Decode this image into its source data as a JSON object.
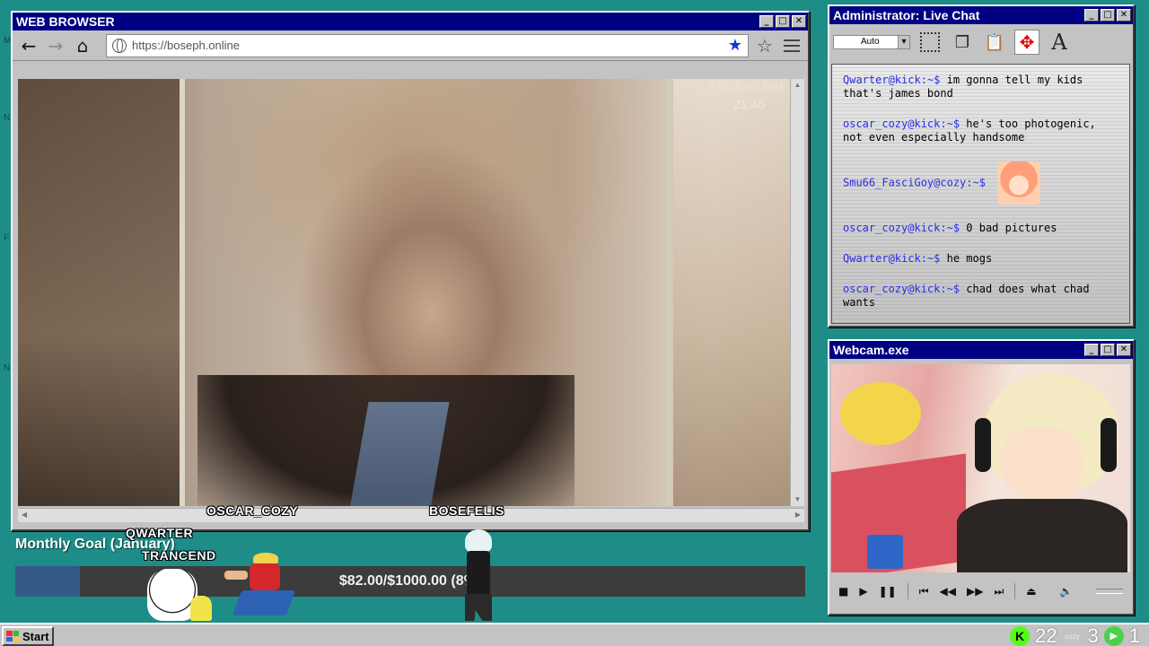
{
  "browser": {
    "title": "WEB BROWSER",
    "url": "https://boseph.online",
    "video": {
      "overlay_title": "Abraham Mat",
      "timestamp": "21:45"
    }
  },
  "chat": {
    "title": "Administrator: Live Chat",
    "zoom_select": "Auto",
    "messages": [
      {
        "user": "Qwarter@kick:~$",
        "text": "im gonna tell my kids that's james bond"
      },
      {
        "user": "oscar_cozy@kick:~$",
        "text": "he's too photogenic, not even especially handsome"
      },
      {
        "user": "Smu66_FasciGoy@cozy:~$",
        "text": ""
      },
      {
        "user": "oscar_cozy@kick:~$",
        "text": "0 bad pictures"
      },
      {
        "user": "Qwarter@kick:~$",
        "text": "he mogs"
      },
      {
        "user": "oscar_cozy@kick:~$",
        "text": "chad does what chad wants"
      }
    ]
  },
  "webcam": {
    "title": "Webcam.exe"
  },
  "goal": {
    "title": "Monthly Goal (January)",
    "progress_text": "$82.00/$1000.00 (8%)",
    "raised": 82.0,
    "target": 1000.0,
    "fraction": 0.082
  },
  "sprites": {
    "labels": [
      "QWARTER",
      "TRANCEND",
      "OSCAR_COZY",
      "BOSEFELIS"
    ]
  },
  "taskbar": {
    "start_label": "Start",
    "tray": {
      "kick_count": "22",
      "cozy_count": "3",
      "other_count": "1"
    }
  },
  "colors": {
    "desktop": "#1e8c87",
    "titlebar": "#000082",
    "chat_user": "#2a2ee8",
    "goal_fill": "#355987",
    "kick_green": "#53fc18"
  }
}
